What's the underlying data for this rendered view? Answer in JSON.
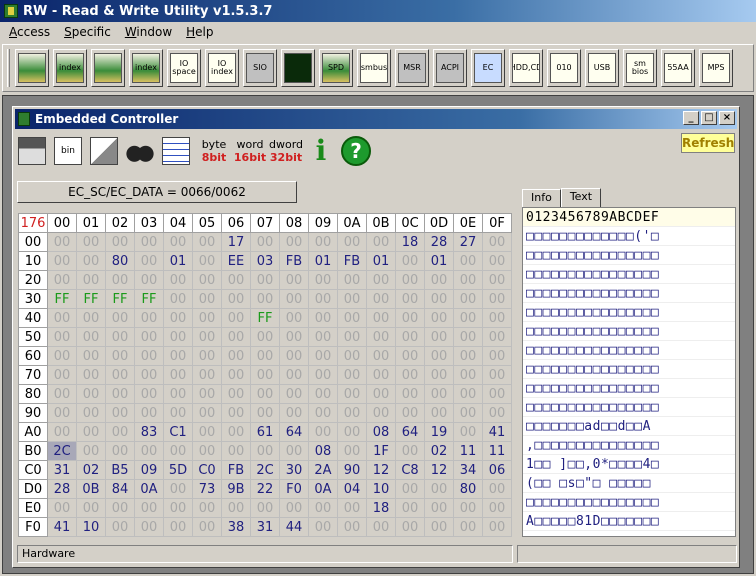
{
  "app": {
    "title": "RW - Read & Write Utility v1.5.3.7"
  },
  "menu": [
    {
      "label": "Access",
      "key": "A"
    },
    {
      "label": "Specific",
      "key": "S"
    },
    {
      "label": "Window",
      "key": "W"
    },
    {
      "label": "Help",
      "key": "H"
    }
  ],
  "toolbar": [
    {
      "name": "pci-icon",
      "text": "",
      "style": "ico-green"
    },
    {
      "name": "pci-index-icon",
      "text": "index",
      "style": "ico-green"
    },
    {
      "name": "memory-icon",
      "text": "",
      "style": "ico-green"
    },
    {
      "name": "memory-index-icon",
      "text": "index",
      "style": "ico-green"
    },
    {
      "name": "io-space-icon",
      "text": "IO space",
      "style": "ico-paper"
    },
    {
      "name": "io-index-icon",
      "text": "IO index",
      "style": "ico-paper"
    },
    {
      "name": "super-io-icon",
      "text": "SIO",
      "style": "ico-grey"
    },
    {
      "name": "waveform-icon",
      "text": "",
      "style": "ico-wave"
    },
    {
      "name": "spd-icon",
      "text": "SPD",
      "style": "ico-green"
    },
    {
      "name": "smbus-icon",
      "text": "smbus",
      "style": "ico-paper"
    },
    {
      "name": "msr-icon",
      "text": "MSR",
      "style": "ico-grey"
    },
    {
      "name": "acpi-icon",
      "text": "ACPI",
      "style": "ico-grey"
    },
    {
      "name": "ec-icon",
      "text": "EC",
      "style": "ico-blue"
    },
    {
      "name": "hdd-cd-icon",
      "text": "HDD,CD",
      "style": "ico-paper"
    },
    {
      "name": "disk-icon",
      "text": "010",
      "style": "ico-paper"
    },
    {
      "name": "usb-icon",
      "text": "USB",
      "style": "ico-paper"
    },
    {
      "name": "smbios-icon",
      "text": "sm bios",
      "style": "ico-paper"
    },
    {
      "name": "rom-55aa-icon",
      "text": "55AA",
      "style": "ico-paper"
    },
    {
      "name": "mps-icon",
      "text": "MPS",
      "style": "ico-paper"
    }
  ],
  "window": {
    "title": "Embedded Controller",
    "refresh_label": "Refresh",
    "port_label": "EC_SC/EC_DATA = 0066/0062",
    "width_buttons": [
      {
        "top": "byte",
        "bottom": "8bit"
      },
      {
        "top": "word",
        "bottom": "16bit"
      },
      {
        "top": "dword",
        "bottom": "32bit"
      }
    ],
    "info_label": "i",
    "help_label": "?",
    "tabs": [
      "Info",
      "Text"
    ],
    "active_tab": "Text",
    "status": "Hardware"
  },
  "grid": {
    "corner": "176",
    "columns": [
      "00",
      "01",
      "02",
      "03",
      "04",
      "05",
      "06",
      "07",
      "08",
      "09",
      "0A",
      "0B",
      "0C",
      "0D",
      "0E",
      "0F"
    ],
    "rows": [
      {
        "addr": "00",
        "cells": [
          "00",
          "00",
          "00",
          "00",
          "00",
          "00",
          "17",
          "00",
          "00",
          "00",
          "00",
          "00",
          "18",
          "28",
          "27",
          "00"
        ]
      },
      {
        "addr": "10",
        "cells": [
          "00",
          "00",
          "80",
          "00",
          "01",
          "00",
          "EE",
          "03",
          "FB",
          "01",
          "FB",
          "01",
          "00",
          "01",
          "00",
          "00"
        ]
      },
      {
        "addr": "20",
        "cells": [
          "00",
          "00",
          "00",
          "00",
          "00",
          "00",
          "00",
          "00",
          "00",
          "00",
          "00",
          "00",
          "00",
          "00",
          "00",
          "00"
        ]
      },
      {
        "addr": "30",
        "cells": [
          "FF",
          "FF",
          "FF",
          "FF",
          "00",
          "00",
          "00",
          "00",
          "00",
          "00",
          "00",
          "00",
          "00",
          "00",
          "00",
          "00"
        ]
      },
      {
        "addr": "40",
        "cells": [
          "00",
          "00",
          "00",
          "00",
          "00",
          "00",
          "00",
          "FF",
          "00",
          "00",
          "00",
          "00",
          "00",
          "00",
          "00",
          "00"
        ]
      },
      {
        "addr": "50",
        "cells": [
          "00",
          "00",
          "00",
          "00",
          "00",
          "00",
          "00",
          "00",
          "00",
          "00",
          "00",
          "00",
          "00",
          "00",
          "00",
          "00"
        ]
      },
      {
        "addr": "60",
        "cells": [
          "00",
          "00",
          "00",
          "00",
          "00",
          "00",
          "00",
          "00",
          "00",
          "00",
          "00",
          "00",
          "00",
          "00",
          "00",
          "00"
        ]
      },
      {
        "addr": "70",
        "cells": [
          "00",
          "00",
          "00",
          "00",
          "00",
          "00",
          "00",
          "00",
          "00",
          "00",
          "00",
          "00",
          "00",
          "00",
          "00",
          "00"
        ]
      },
      {
        "addr": "80",
        "cells": [
          "00",
          "00",
          "00",
          "00",
          "00",
          "00",
          "00",
          "00",
          "00",
          "00",
          "00",
          "00",
          "00",
          "00",
          "00",
          "00"
        ]
      },
      {
        "addr": "90",
        "cells": [
          "00",
          "00",
          "00",
          "00",
          "00",
          "00",
          "00",
          "00",
          "00",
          "00",
          "00",
          "00",
          "00",
          "00",
          "00",
          "00"
        ]
      },
      {
        "addr": "A0",
        "cells": [
          "00",
          "00",
          "00",
          "83",
          "C1",
          "00",
          "00",
          "61",
          "64",
          "00",
          "00",
          "08",
          "64",
          "19",
          "00",
          "41"
        ]
      },
      {
        "addr": "B0",
        "cells": [
          "2C",
          "00",
          "00",
          "00",
          "00",
          "00",
          "00",
          "00",
          "00",
          "08",
          "00",
          "1F",
          "00",
          "02",
          "11",
          "11"
        ]
      },
      {
        "addr": "C0",
        "cells": [
          "31",
          "02",
          "B5",
          "09",
          "5D",
          "C0",
          "FB",
          "2C",
          "30",
          "2A",
          "90",
          "12",
          "C8",
          "12",
          "34",
          "06"
        ]
      },
      {
        "addr": "D0",
        "cells": [
          "28",
          "0B",
          "84",
          "0A",
          "00",
          "73",
          "9B",
          "22",
          "F0",
          "0A",
          "04",
          "10",
          "00",
          "00",
          "80",
          "00"
        ]
      },
      {
        "addr": "E0",
        "cells": [
          "00",
          "00",
          "00",
          "00",
          "00",
          "00",
          "00",
          "00",
          "00",
          "00",
          "00",
          "18",
          "00",
          "00",
          "00",
          "00"
        ]
      },
      {
        "addr": "F0",
        "cells": [
          "41",
          "10",
          "00",
          "00",
          "00",
          "00",
          "38",
          "31",
          "44",
          "00",
          "00",
          "00",
          "00",
          "00",
          "00",
          "00"
        ]
      }
    ]
  },
  "text_view": {
    "header": "0123456789ABCDEF",
    "rows": [
      "□□□□□□□□□□□□□('□",
      "□□□□□□□□□□□□□□□□",
      "□□□□□□□□□□□□□□□□",
      "□□□□□□□□□□□□□□□□",
      "□□□□□□□□□□□□□□□□",
      "□□□□□□□□□□□□□□□□",
      "□□□□□□□□□□□□□□□□",
      "□□□□□□□□□□□□□□□□",
      "□□□□□□□□□□□□□□□□",
      "□□□□□□□□□□□□□□□□",
      "□□□□□□□ad□□d□□A",
      ",□□□□□□□□□□□□□□□",
      "1□□ ]□□,0*□□□□4□",
      "(□□ □s□\"□ □□□□□",
      "□□□□□□□□□□□□□□□□",
      "A□□□□□81D□□□□□□□"
    ]
  }
}
